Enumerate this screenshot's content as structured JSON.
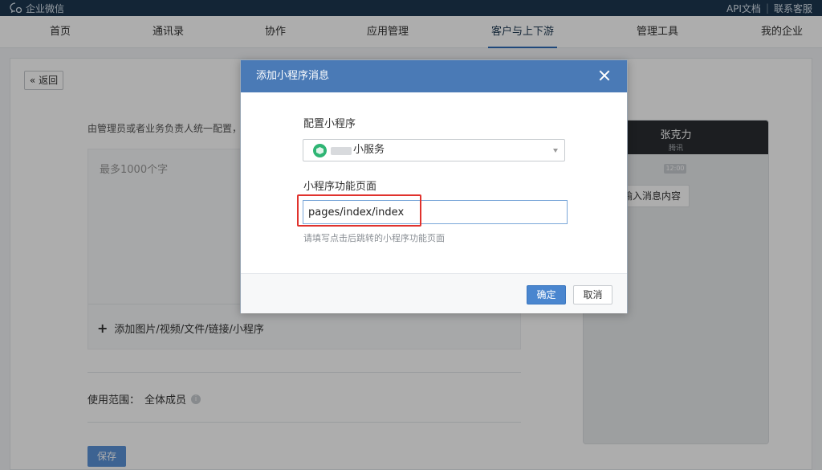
{
  "topbar": {
    "brand": "企业微信",
    "links": [
      "API文档",
      "联系客服"
    ]
  },
  "nav": {
    "items": [
      "首页",
      "通讯录",
      "协作",
      "应用管理",
      "客户与上下游",
      "管理工具",
      "我的企业"
    ],
    "active": "客户与上下游"
  },
  "page": {
    "back_label": "返回",
    "hint": "由管理员或者业务负责人统一配置，",
    "editor_placeholder": "最多1000个字",
    "add_attachment": "添加图片/视频/文件/链接/小程序",
    "scope_label": "使用范围：",
    "scope_value": "全体成员",
    "save_label": "保存"
  },
  "phone": {
    "contact_name": "张克力",
    "contact_sub": "腾讯",
    "time": "12:00",
    "bubble": "输入消息内容"
  },
  "modal": {
    "title": "添加小程序消息",
    "miniprogram_label": "配置小程序",
    "miniprogram_value": "小服务",
    "page_label": "小程序功能页面",
    "page_value": "pages/index/index",
    "help_text": "请填写点击后跳转的小程序功能页面",
    "ok_label": "确定",
    "cancel_label": "取消"
  },
  "colors": {
    "topbar": "#1c3750",
    "modal_header": "#4a7ab6",
    "primary_button": "#4a86cf",
    "highlight": "#e0322d",
    "miniprogram_icon": "#2fb574"
  }
}
